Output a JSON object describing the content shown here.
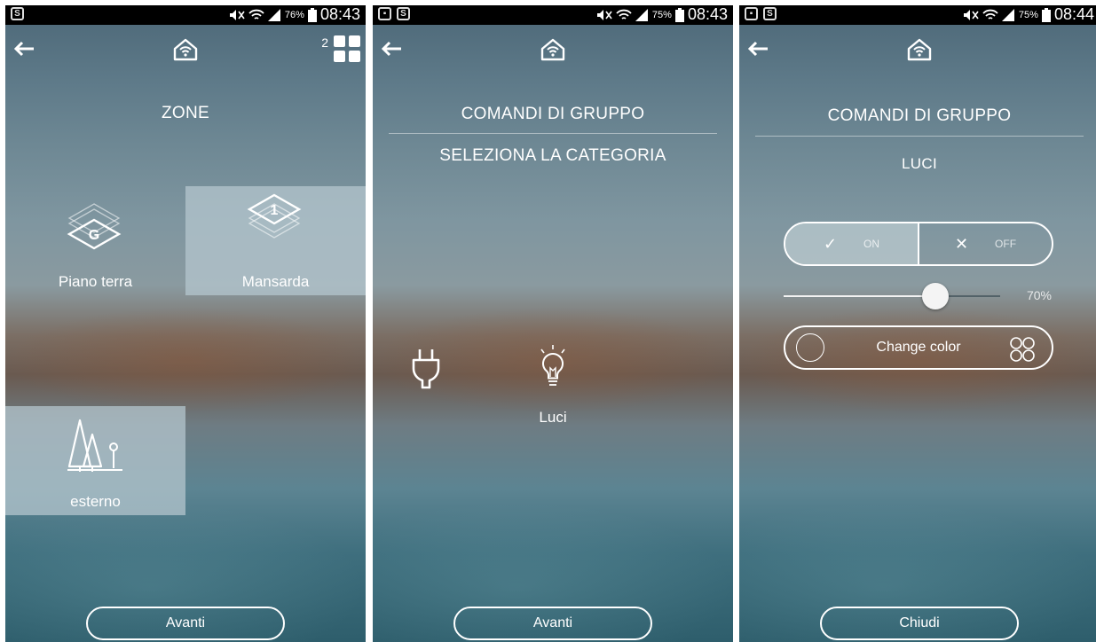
{
  "screens": [
    {
      "status": {
        "battery": "76%",
        "time": "08:43"
      },
      "grid_count": "2",
      "title": "ZONE",
      "zones": [
        {
          "label": "Piano terra",
          "badge": "G",
          "selected": false
        },
        {
          "label": "Mansarda",
          "badge": "1",
          "selected": true
        },
        {
          "label": "esterno",
          "selected": true
        }
      ],
      "button": "Avanti"
    },
    {
      "status": {
        "battery": "75%",
        "time": "08:43"
      },
      "title": "COMANDI DI GRUPPO",
      "subtitle": "SELEZIONA LA CATEGORIA",
      "categories": [
        {
          "label": "",
          "icon": "plug-icon"
        },
        {
          "label": "Luci",
          "icon": "lightbulb-icon"
        }
      ],
      "button": "Avanti"
    },
    {
      "status": {
        "battery": "75%",
        "time": "08:44"
      },
      "title": "COMANDI DI GRUPPO",
      "subtitle": "LUCI",
      "toggle": {
        "on_label": "ON",
        "off_label": "OFF",
        "state": "on"
      },
      "brightness": {
        "value": 0.7,
        "label": "70%"
      },
      "color_button": "Change color",
      "button": "Chiudi"
    }
  ]
}
